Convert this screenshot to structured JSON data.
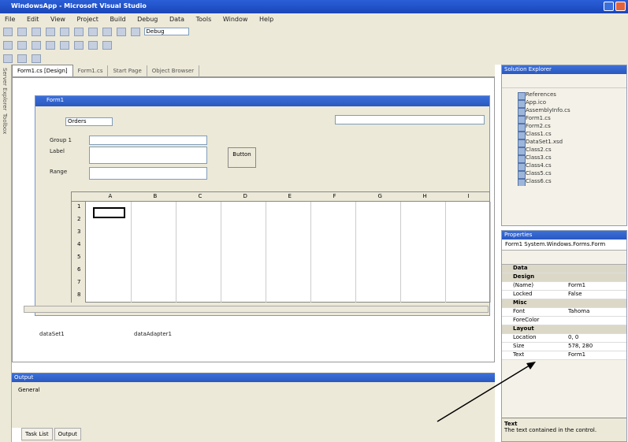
{
  "window": {
    "title": "WindowsApp - Microsoft Visual Studio"
  },
  "menu": [
    "File",
    "Edit",
    "View",
    "Project",
    "Build",
    "Debug",
    "Data",
    "Tools",
    "Window",
    "Help"
  ],
  "toolbar": {
    "config": "Debug"
  },
  "left_tabs": [
    "Server Explorer",
    "Toolbox"
  ],
  "doc_tabs": [
    {
      "label": "Form1.cs [Design]",
      "active": true
    },
    {
      "label": "Form1.cs",
      "active": false
    },
    {
      "label": "Start Page",
      "active": false
    },
    {
      "label": "Object Browser",
      "active": false
    }
  ],
  "form": {
    "title": "Form1",
    "tab_label": "Orders",
    "labels": {
      "a": "Group 1",
      "b": "Label",
      "c": "Range"
    },
    "button": "Button"
  },
  "grid": {
    "columns": [
      "A",
      "B",
      "C",
      "D",
      "E",
      "F",
      "G",
      "H",
      "I"
    ],
    "rows": [
      "1",
      "2",
      "3",
      "4",
      "5",
      "6",
      "7",
      "8"
    ]
  },
  "components": [
    "dataSet1",
    "dataAdapter1"
  ],
  "output": {
    "title": "Output",
    "tab": "General"
  },
  "bottom_tabs": [
    "Task List",
    "Output"
  ],
  "solution": {
    "title": "Solution Explorer",
    "items": [
      "References",
      "App.ico",
      "AssemblyInfo.cs",
      "Form1.cs",
      "Form2.cs",
      "Class1.cs",
      "DataSet1.xsd",
      "Class2.cs",
      "Class3.cs",
      "Class4.cs",
      "Class5.cs",
      "Class6.cs"
    ]
  },
  "properties": {
    "title": "Properties",
    "object": "Form1 System.Windows.Forms.Form",
    "rows": [
      {
        "name": "Data",
        "value": "",
        "category": true
      },
      {
        "name": "Design",
        "value": "",
        "category": true
      },
      {
        "name": "(Name)",
        "value": "Form1",
        "category": false
      },
      {
        "name": "Locked",
        "value": "False",
        "category": false
      },
      {
        "name": "Misc",
        "value": "",
        "category": true
      },
      {
        "name": "Font",
        "value": "Tahoma",
        "category": false
      },
      {
        "name": "ForeColor",
        "value": "",
        "category": false
      },
      {
        "name": "Layout",
        "value": "",
        "category": true
      },
      {
        "name": "Location",
        "value": "0, 0",
        "category": false
      },
      {
        "name": "Size",
        "value": "578, 280",
        "category": false
      },
      {
        "name": "Text",
        "value": "Form1",
        "category": false
      }
    ],
    "desc_title": "Text",
    "desc": "The text contained in the control."
  },
  "colors": {
    "title_blue": "#2a5fd8",
    "chrome": "#ece9d8"
  }
}
